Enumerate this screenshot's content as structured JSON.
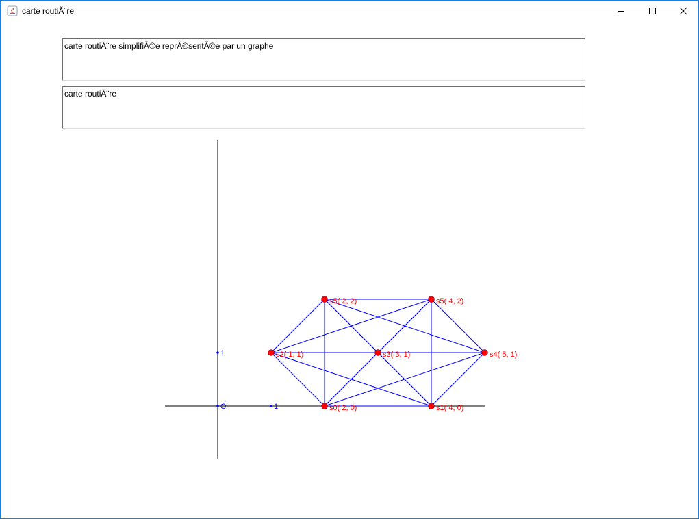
{
  "window": {
    "title": "carte routiÃ¨re",
    "controls": {
      "minimize": "minimize",
      "maximize": "maximize",
      "close": "close"
    }
  },
  "description_field": {
    "value": "carte routiÃ¨re simplifiÃ©e reprÃ©sentÃ©e par un graphe"
  },
  "name_field": {
    "value": "carte routiÃ¨re"
  },
  "graph": {
    "axis_labels": {
      "origin": "O",
      "x_unit": "1",
      "y_unit": "1"
    },
    "nodes": [
      {
        "id": "s0",
        "label": "s0( 2, 0)",
        "x": 2,
        "y": 0
      },
      {
        "id": "s1",
        "label": "s1( 4, 0)",
        "x": 4,
        "y": 0
      },
      {
        "id": "s2",
        "label": "s2( 1, 1)",
        "x": 1,
        "y": 1
      },
      {
        "id": "s3",
        "label": "s3( 3, 1)",
        "x": 3,
        "y": 1
      },
      {
        "id": "s4",
        "label": "s4( 5, 1)",
        "x": 5,
        "y": 1
      },
      {
        "id": "s5a",
        "label": "s5( 2, 2)",
        "x": 2,
        "y": 2
      },
      {
        "id": "s5b",
        "label": "s5( 4, 2)",
        "x": 4,
        "y": 2
      }
    ],
    "edges": [
      [
        "s0",
        "s1"
      ],
      [
        "s0",
        "s2"
      ],
      [
        "s0",
        "s3"
      ],
      [
        "s0",
        "s4"
      ],
      [
        "s0",
        "s5a"
      ],
      [
        "s0",
        "s5b"
      ],
      [
        "s1",
        "s2"
      ],
      [
        "s1",
        "s3"
      ],
      [
        "s1",
        "s4"
      ],
      [
        "s1",
        "s5a"
      ],
      [
        "s1",
        "s5b"
      ],
      [
        "s2",
        "s3"
      ],
      [
        "s2",
        "s5a"
      ],
      [
        "s2",
        "s5b"
      ],
      [
        "s3",
        "s4"
      ],
      [
        "s3",
        "s5a"
      ],
      [
        "s3",
        "s5b"
      ],
      [
        "s4",
        "s5a"
      ],
      [
        "s4",
        "s5b"
      ],
      [
        "s5a",
        "s5b"
      ]
    ],
    "colors": {
      "edge": "#0000ff",
      "node": "#ff0000",
      "node_label": "#ff0000",
      "axis": "#000000",
      "axis_marker": "#0000ff"
    }
  }
}
